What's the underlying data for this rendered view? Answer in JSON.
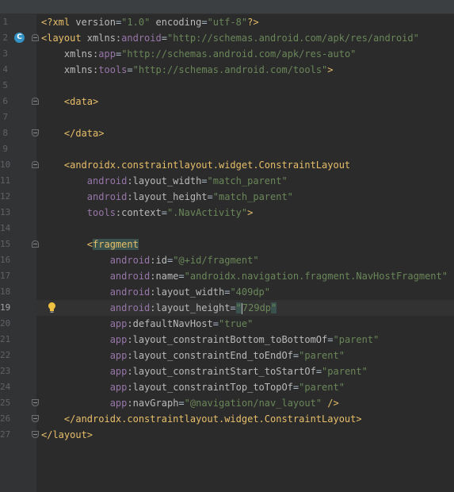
{
  "editor": {
    "file_language": "xml",
    "gutter_icon_letter": "C",
    "current_line": 19,
    "lines": [
      {
        "n": "1",
        "segs": [
          [
            "pi",
            "<?xml "
          ],
          [
            "attr",
            "version"
          ],
          [
            "plain",
            "="
          ],
          [
            "val",
            "\"1.0\""
          ],
          [
            "plain",
            " "
          ],
          [
            "attr",
            "encoding"
          ],
          [
            "plain",
            "="
          ],
          [
            "val",
            "\"utf-8\""
          ],
          [
            "pi",
            "?>"
          ]
        ]
      },
      {
        "n": "2",
        "segs": [
          [
            "tag",
            "<layout "
          ],
          [
            "attr",
            "xmlns:"
          ],
          [
            "ns",
            "android"
          ],
          [
            "plain",
            "="
          ],
          [
            "val",
            "\"http://schemas.android.com/apk/res/android\""
          ]
        ]
      },
      {
        "n": "3",
        "segs": [
          [
            "plain",
            "    "
          ],
          [
            "attr",
            "xmlns:"
          ],
          [
            "ns",
            "app"
          ],
          [
            "plain",
            "="
          ],
          [
            "val",
            "\"http://schemas.android.com/apk/res-auto\""
          ]
        ]
      },
      {
        "n": "4",
        "segs": [
          [
            "plain",
            "    "
          ],
          [
            "attr",
            "xmlns:"
          ],
          [
            "ns",
            "tools"
          ],
          [
            "plain",
            "="
          ],
          [
            "val",
            "\"http://schemas.android.com/tools\""
          ],
          [
            "tag",
            ">"
          ]
        ]
      },
      {
        "n": "5",
        "segs": []
      },
      {
        "n": "6",
        "segs": [
          [
            "plain",
            "    "
          ],
          [
            "tag",
            "<data>"
          ]
        ]
      },
      {
        "n": "7",
        "segs": []
      },
      {
        "n": "8",
        "segs": [
          [
            "plain",
            "    "
          ],
          [
            "tag",
            "</data>"
          ]
        ]
      },
      {
        "n": "9",
        "segs": []
      },
      {
        "n": "10",
        "segs": [
          [
            "plain",
            "    "
          ],
          [
            "tag",
            "<androidx.constraintlayout.widget.ConstraintLayout"
          ]
        ]
      },
      {
        "n": "11",
        "segs": [
          [
            "plain",
            "        "
          ],
          [
            "ns",
            "android"
          ],
          [
            "attr",
            ":layout_width"
          ],
          [
            "plain",
            "="
          ],
          [
            "val",
            "\"match_parent\""
          ]
        ]
      },
      {
        "n": "12",
        "segs": [
          [
            "plain",
            "        "
          ],
          [
            "ns",
            "android"
          ],
          [
            "attr",
            ":layout_height"
          ],
          [
            "plain",
            "="
          ],
          [
            "val",
            "\"match_parent\""
          ]
        ]
      },
      {
        "n": "13",
        "segs": [
          [
            "plain",
            "        "
          ],
          [
            "ns",
            "tools"
          ],
          [
            "attr",
            ":context"
          ],
          [
            "plain",
            "="
          ],
          [
            "val",
            "\".NavActivity\""
          ],
          [
            "tag",
            ">"
          ]
        ]
      },
      {
        "n": "14",
        "segs": []
      },
      {
        "n": "15",
        "segs": [
          [
            "plain",
            "        "
          ],
          [
            "tag",
            "<"
          ],
          [
            "taghl",
            "fragment"
          ]
        ]
      },
      {
        "n": "16",
        "segs": [
          [
            "plain",
            "            "
          ],
          [
            "ns",
            "android"
          ],
          [
            "attr",
            ":id"
          ],
          [
            "plain",
            "="
          ],
          [
            "val",
            "\"@+id/fragment\""
          ]
        ]
      },
      {
        "n": "17",
        "segs": [
          [
            "plain",
            "            "
          ],
          [
            "ns",
            "android"
          ],
          [
            "attr",
            ":name"
          ],
          [
            "plain",
            "="
          ],
          [
            "val",
            "\"androidx.navigation.fragment.NavHostFragment\""
          ]
        ]
      },
      {
        "n": "18",
        "segs": [
          [
            "plain",
            "            "
          ],
          [
            "ns",
            "android"
          ],
          [
            "attr",
            ":layout_width"
          ],
          [
            "plain",
            "="
          ],
          [
            "val",
            "\"409dp\""
          ]
        ]
      },
      {
        "n": "19",
        "segs": [
          [
            "plain",
            "            "
          ],
          [
            "ns",
            "android"
          ],
          [
            "attr",
            ":layout_height"
          ],
          [
            "plain",
            "="
          ],
          [
            "qhl",
            "\""
          ],
          [
            "val",
            "729dp"
          ],
          [
            "qhl",
            "\""
          ]
        ]
      },
      {
        "n": "20",
        "segs": [
          [
            "plain",
            "            "
          ],
          [
            "ns",
            "app"
          ],
          [
            "attr",
            ":defaultNavHost"
          ],
          [
            "plain",
            "="
          ],
          [
            "val",
            "\"true\""
          ]
        ]
      },
      {
        "n": "21",
        "segs": [
          [
            "plain",
            "            "
          ],
          [
            "ns",
            "app"
          ],
          [
            "attr",
            ":layout_constraintBottom_toBottomOf"
          ],
          [
            "plain",
            "="
          ],
          [
            "val",
            "\"parent\""
          ]
        ]
      },
      {
        "n": "22",
        "segs": [
          [
            "plain",
            "            "
          ],
          [
            "ns",
            "app"
          ],
          [
            "attr",
            ":layout_constraintEnd_toEndOf"
          ],
          [
            "plain",
            "="
          ],
          [
            "val",
            "\"parent\""
          ]
        ]
      },
      {
        "n": "23",
        "segs": [
          [
            "plain",
            "            "
          ],
          [
            "ns",
            "app"
          ],
          [
            "attr",
            ":layout_constraintStart_toStartOf"
          ],
          [
            "plain",
            "="
          ],
          [
            "val",
            "\"parent\""
          ]
        ]
      },
      {
        "n": "24",
        "segs": [
          [
            "plain",
            "            "
          ],
          [
            "ns",
            "app"
          ],
          [
            "attr",
            ":layout_constraintTop_toTopOf"
          ],
          [
            "plain",
            "="
          ],
          [
            "val",
            "\"parent\""
          ]
        ]
      },
      {
        "n": "25",
        "segs": [
          [
            "plain",
            "            "
          ],
          [
            "ns",
            "app"
          ],
          [
            "attr",
            ":navGraph"
          ],
          [
            "plain",
            "="
          ],
          [
            "val",
            "\"@navigation/nav_layout\""
          ],
          [
            "plain",
            " "
          ],
          [
            "tag",
            "/>"
          ]
        ]
      },
      {
        "n": "26",
        "segs": [
          [
            "plain",
            "    "
          ],
          [
            "tag",
            "</androidx.constraintlayout.widget.ConstraintLayout>"
          ]
        ]
      },
      {
        "n": "27",
        "segs": [
          [
            "tag",
            "</layout>"
          ]
        ]
      }
    ]
  },
  "fold_markers": {
    "2": "start",
    "6": "start",
    "8": "end",
    "10": "start",
    "15": "start",
    "25": "end",
    "26": "end",
    "27": "end"
  },
  "colors": {
    "background": "#2b2b2b",
    "gutter": "#313335",
    "tag": "#e8bf6a",
    "attribute": "#bababa",
    "namespace": "#9876aa",
    "string": "#6a8759",
    "line_number": "#606366"
  }
}
